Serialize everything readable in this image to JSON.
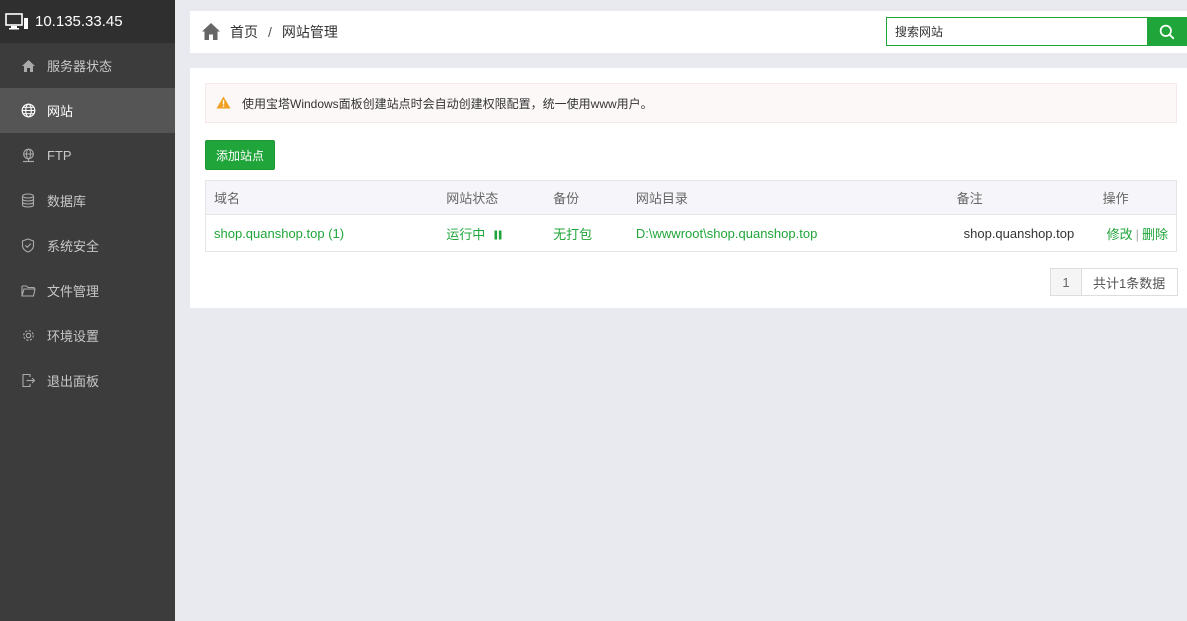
{
  "sidebar": {
    "server_ip": "10.135.33.45",
    "items": [
      {
        "label": "服务器状态",
        "icon": "home-icon"
      },
      {
        "label": "网站",
        "icon": "globe-icon"
      },
      {
        "label": "FTP",
        "icon": "ftp-icon"
      },
      {
        "label": "数据库",
        "icon": "database-icon"
      },
      {
        "label": "系统安全",
        "icon": "shield-icon"
      },
      {
        "label": "文件管理",
        "icon": "folder-icon"
      },
      {
        "label": "环境设置",
        "icon": "gear-icon"
      },
      {
        "label": "退出面板",
        "icon": "logout-icon"
      }
    ],
    "active_index": 1
  },
  "breadcrumb": {
    "home": "首页",
    "separator": "/",
    "current": "网站管理"
  },
  "search": {
    "placeholder": "搜索网站"
  },
  "notice": {
    "text": "使用宝塔Windows面板创建站点时会自动创建权限配置，统一使用www用户。"
  },
  "toolbar": {
    "add_site_label": "添加站点"
  },
  "table": {
    "headers": [
      "域名",
      "网站状态",
      "备份",
      "网站目录",
      "备注",
      "操作"
    ],
    "rows": [
      {
        "domain": "shop.quanshop.top (1)",
        "status": "运行中",
        "backup": "无打包",
        "directory": "D:\\wwwroot\\shop.quanshop.top",
        "remark": "shop.quanshop.top",
        "edit_label": "修改",
        "divider": "|",
        "delete_label": "删除"
      }
    ]
  },
  "pagination": {
    "page": "1",
    "total": "共计1条数据"
  },
  "colors": {
    "accent": "#20a53a",
    "sidebar_bg": "#3c3c3c",
    "sidebar_active": "#555555",
    "warning": "#f0a020"
  }
}
